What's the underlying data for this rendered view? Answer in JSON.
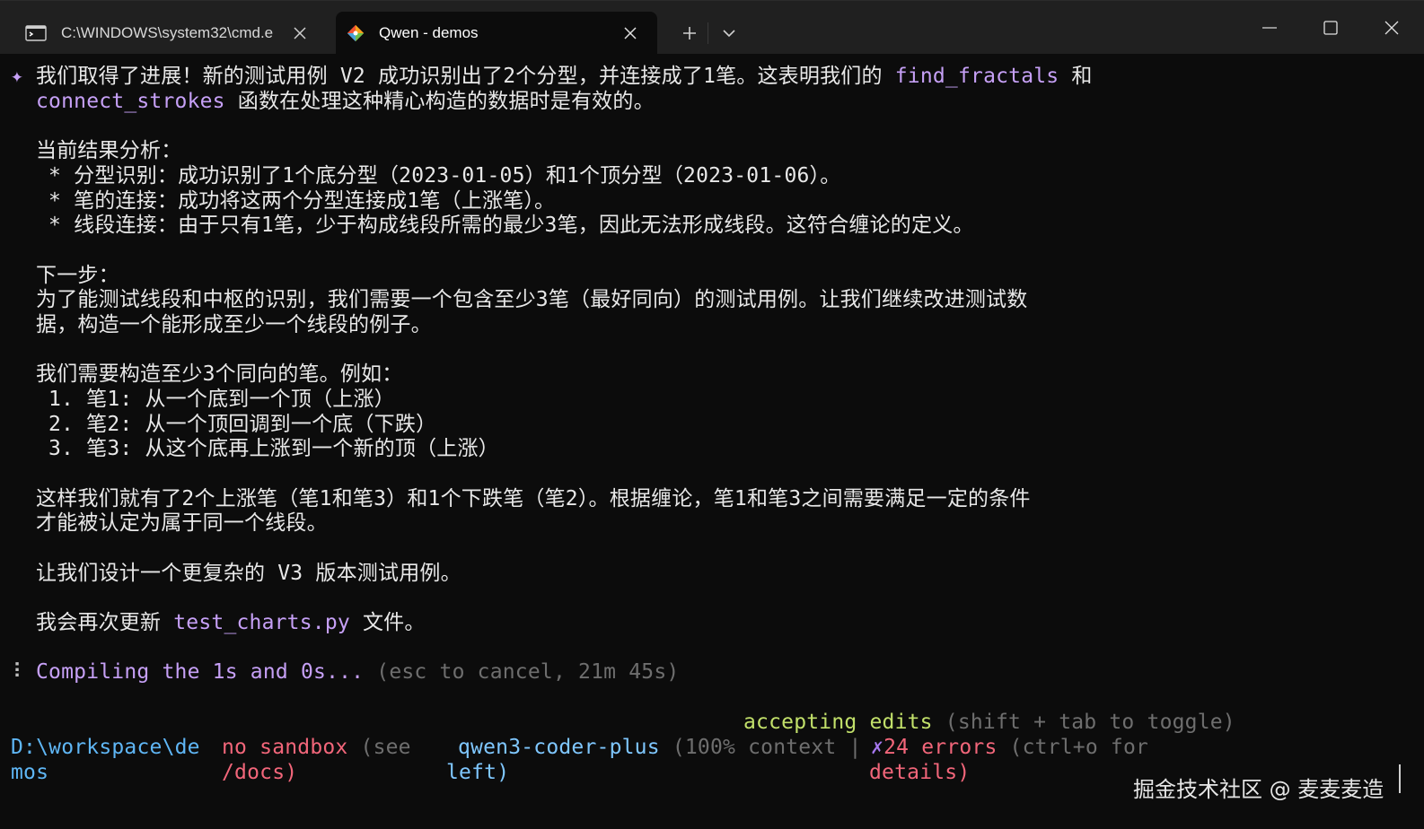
{
  "window": {
    "tabs": [
      {
        "title": "C:\\WINDOWS\\system32\\cmd.e",
        "icon": "cmd-icon",
        "active": false
      },
      {
        "title": "Qwen - demos",
        "icon": "git-icon",
        "active": true
      }
    ],
    "new_tab_label": "+",
    "colors": {
      "titlebar": "#202020",
      "terminal_bg": "#0c0c0c",
      "accent_purple": "#c6a0f6"
    }
  },
  "content": {
    "star": "✦",
    "l1_a": "我们取得了进展！新的测试用例 V2 成功识别出了2个分型，并连接成了1笔。这表明我们的 ",
    "l1_code1": "find_fractals",
    "l1_b": " 和",
    "l2_code": "connect_strokes",
    "l2_b": " 函数在处理这种精心构造的数据时是有效的。",
    "analysis_title": "当前结果分析：",
    "analysis": [
      "* 分型识别：成功识别了1个底分型（2023-01-05）和1个顶分型（2023-01-06）。",
      "* 笔的连接：成功将这两个分型连接成1笔（上涨笔）。",
      "* 线段连接：由于只有1笔，少于构成线段所需的最少3笔，因此无法形成线段。这符合缠论的定义。"
    ],
    "next_title": "下一步：",
    "next_1": "为了能测试线段和中枢的识别，我们需要一个包含至少3笔（最好同向）的测试用例。让我们继续改进测试数",
    "next_2": "据，构造一个能形成至少一个线段的例子。",
    "need_title": "我们需要构造至少3个同向的笔。例如：",
    "steps": [
      "1. 笔1: 从一个底到一个顶（上涨）",
      "2. 笔2: 从一个顶回调到一个底（下跌）",
      "3. 笔3: 从这个底再上涨到一个新的顶（上涨）"
    ],
    "sum_1": "这样我们就有了2个上涨笔（笔1和笔3）和1个下跌笔（笔2）。根据缠论，笔1和笔3之间需要满足一定的条件",
    "sum_2": "才能被认定为属于同一个线段。",
    "design": "让我们设计一个更复杂的 V3 版本测试用例。",
    "update_a": "我会再次更新 ",
    "update_file": "test_charts.py",
    "update_b": " 文件。",
    "spinner": "⠇",
    "compiling": "Compiling the 1s and 0s...",
    "compiling_hint": " (esc to cancel, 21m 45s)"
  },
  "statusbar": {
    "accepting_a": "accepting edits",
    "accepting_hint": " (shift + tab to toggle)",
    "path_1": "D:\\workspace\\de",
    "path_2": "mos",
    "sandbox": "no sandbox",
    "sandbox_hint_1": " (see",
    "sandbox_hint_2": "/docs)",
    "model": "qwen3-coder-plus",
    "model_hint_1": " (100% context |",
    "model_hint_2": "left)",
    "errors_x": "✗",
    "errors": "24 errors",
    "errors_hint_1": " (ctrl+o for",
    "errors_hint_2": "details)"
  },
  "watermark": "掘金技术社区 @ 麦麦麦造"
}
